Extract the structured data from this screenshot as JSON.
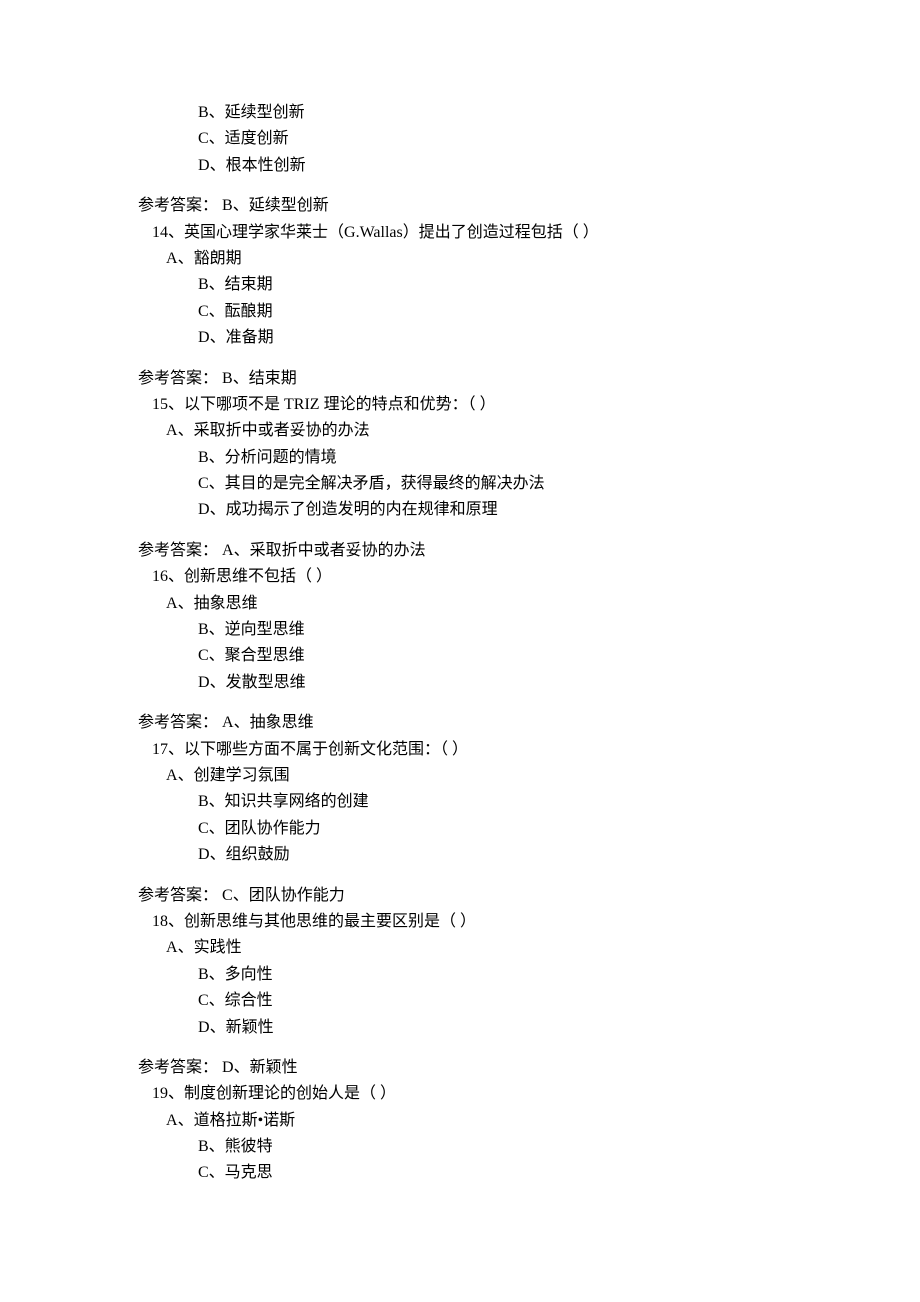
{
  "lines": [
    {
      "cls": "opt-indent",
      "text": "B、延续型创新"
    },
    {
      "cls": "opt-indent",
      "text": "C、适度创新"
    },
    {
      "cls": "opt-indent",
      "text": "D、根本性创新"
    },
    {
      "cls": "blank",
      "text": ""
    },
    {
      "cls": "ans",
      "text": "参考答案：  B、延续型创新"
    },
    {
      "cls": "q-line",
      "text": "14、英国心理学家华莱士（G.Wallas）提出了创造过程包括（  ）"
    },
    {
      "cls": "opt-a",
      "text": "A、豁朗期"
    },
    {
      "cls": "opt-indent",
      "text": "B、结束期"
    },
    {
      "cls": "opt-indent",
      "text": "C、酝酿期"
    },
    {
      "cls": "opt-indent",
      "text": "D、准备期"
    },
    {
      "cls": "blank",
      "text": ""
    },
    {
      "cls": "ans",
      "text": "参考答案：  B、结束期"
    },
    {
      "cls": "q-line",
      "text": "15、以下哪项不是 TRIZ 理论的特点和优势：（  ）"
    },
    {
      "cls": "opt-a",
      "text": "A、采取折中或者妥协的办法"
    },
    {
      "cls": "opt-indent",
      "text": "B、分析问题的情境"
    },
    {
      "cls": "opt-indent",
      "text": "C、其目的是完全解决矛盾，获得最终的解决办法"
    },
    {
      "cls": "opt-indent",
      "text": "D、成功揭示了创造发明的内在规律和原理"
    },
    {
      "cls": "blank",
      "text": ""
    },
    {
      "cls": "ans",
      "text": "参考答案：  A、采取折中或者妥协的办法"
    },
    {
      "cls": "q-line",
      "text": "16、创新思维不包括（  ）"
    },
    {
      "cls": "opt-a",
      "text": "A、抽象思维"
    },
    {
      "cls": "opt-indent",
      "text": "B、逆向型思维"
    },
    {
      "cls": "opt-indent",
      "text": "C、聚合型思维"
    },
    {
      "cls": "opt-indent",
      "text": "D、发散型思维"
    },
    {
      "cls": "blank",
      "text": ""
    },
    {
      "cls": "ans",
      "text": "参考答案：  A、抽象思维"
    },
    {
      "cls": "q-line",
      "text": "17、以下哪些方面不属于创新文化范围：（  ）"
    },
    {
      "cls": "opt-a",
      "text": "A、创建学习氛围"
    },
    {
      "cls": "opt-indent",
      "text": "B、知识共享网络的创建"
    },
    {
      "cls": "opt-indent",
      "text": "C、团队协作能力"
    },
    {
      "cls": "opt-indent",
      "text": "D、组织鼓励"
    },
    {
      "cls": "blank",
      "text": ""
    },
    {
      "cls": "ans",
      "text": "参考答案：  C、团队协作能力"
    },
    {
      "cls": "q-line",
      "text": "18、创新思维与其他思维的最主要区别是（  ）"
    },
    {
      "cls": "opt-a",
      "text": "A、实践性"
    },
    {
      "cls": "opt-indent",
      "text": "B、多向性"
    },
    {
      "cls": "opt-indent",
      "text": "C、综合性"
    },
    {
      "cls": "opt-indent",
      "text": "D、新颖性"
    },
    {
      "cls": "blank",
      "text": ""
    },
    {
      "cls": "ans",
      "text": "参考答案：  D、新颖性"
    },
    {
      "cls": "q-line",
      "text": "19、制度创新理论的创始人是（  ）"
    },
    {
      "cls": "opt-a",
      "text": "A、道格拉斯•诺斯"
    },
    {
      "cls": "opt-indent",
      "text": "B、熊彼特"
    },
    {
      "cls": "opt-indent",
      "text": "C、马克思"
    }
  ]
}
